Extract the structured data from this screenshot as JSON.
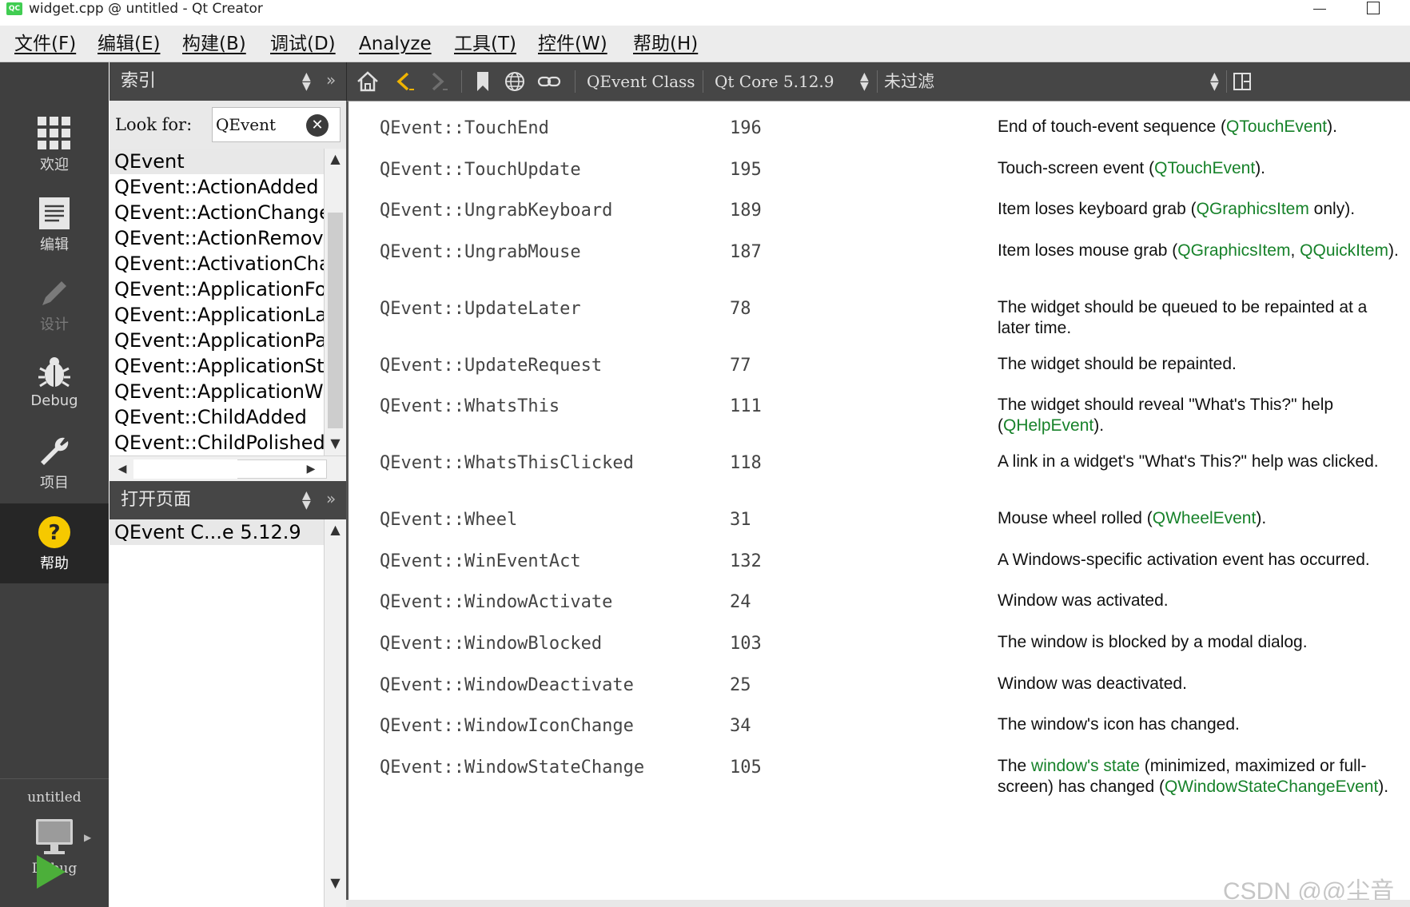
{
  "window": {
    "app_icon_text": "QC",
    "title": "widget.cpp @ untitled - Qt Creator"
  },
  "menu": [
    "文件(F)",
    "编辑(E)",
    "构建(B)",
    "调试(D)",
    "Analyze",
    "工具(T)",
    "控件(W)",
    "帮助(H)"
  ],
  "modes": {
    "welcome": "欢迎",
    "edit": "编辑",
    "design": "设计",
    "debug": "Debug",
    "project": "项目",
    "help": "帮助",
    "kit_name": "untitled",
    "kit_mode": "Debug"
  },
  "index_panel": {
    "title": "索引",
    "look_for_label": "Look for:",
    "search_value": "QEvent",
    "items": [
      "QEvent",
      "QEvent::ActionAdded",
      "QEvent::ActionChanged",
      "QEvent::ActionRemoved",
      "QEvent::ActivationChange",
      "QEvent::ApplicationFontChange",
      "QEvent::ApplicationLayoutDirectionChange",
      "QEvent::ApplicationPaletteChange",
      "QEvent::ApplicationStateChange",
      "QEvent::ApplicationWindowIconChange",
      "QEvent::ChildAdded",
      "QEvent::ChildPolished"
    ]
  },
  "open_pages": {
    "title": "打开页面",
    "items": [
      "QEvent C...e 5.12.9"
    ]
  },
  "toolbar": {
    "doc_title": "QEvent Class",
    "module": "Qt Core 5.12.9",
    "filter": "未过滤"
  },
  "content_rows": [
    {
      "name": "QEvent::TouchEnd",
      "value": "196",
      "desc": [
        {
          "t": "End of touch-event sequence ("
        },
        {
          "t": "QTouchEvent",
          "link": true
        },
        {
          "t": ")."
        }
      ]
    },
    {
      "name": "QEvent::TouchUpdate",
      "value": "195",
      "desc": [
        {
          "t": "Touch-screen event ("
        },
        {
          "t": "QTouchEvent",
          "link": true
        },
        {
          "t": ")."
        }
      ]
    },
    {
      "name": "QEvent::UngrabKeyboard",
      "value": "189",
      "desc": [
        {
          "t": "Item loses keyboard grab ("
        },
        {
          "t": "QGraphicsItem",
          "link": true
        },
        {
          "t": " only)."
        }
      ]
    },
    {
      "name": "QEvent::UngrabMouse",
      "value": "187",
      "desc": [
        {
          "t": "Item loses mouse grab ("
        },
        {
          "t": "QGraphicsItem",
          "link": true
        },
        {
          "t": ", "
        },
        {
          "t": "QQuickItem",
          "link": true
        },
        {
          "t": ")."
        }
      ]
    },
    {
      "name": "QEvent::UpdateLater",
      "value": "78",
      "desc": [
        {
          "t": "The widget should be queued to be repainted at a later time."
        }
      ]
    },
    {
      "name": "QEvent::UpdateRequest",
      "value": "77",
      "desc": [
        {
          "t": "The widget should be repainted."
        }
      ]
    },
    {
      "name": "QEvent::WhatsThis",
      "value": "111",
      "desc": [
        {
          "t": "The widget should reveal \"What's This?\" help ("
        },
        {
          "t": "QHelpEvent",
          "link": true
        },
        {
          "t": ")."
        }
      ]
    },
    {
      "name": "QEvent::WhatsThisClicked",
      "value": "118",
      "desc": [
        {
          "t": "A link in a widget's \"What's This?\" help was clicked."
        }
      ]
    },
    {
      "name": "QEvent::Wheel",
      "value": "31",
      "desc": [
        {
          "t": "Mouse wheel rolled ("
        },
        {
          "t": "QWheelEvent",
          "link": true
        },
        {
          "t": ")."
        }
      ]
    },
    {
      "name": "QEvent::WinEventAct",
      "value": "132",
      "desc": [
        {
          "t": "A Windows-specific activation event has occurred."
        }
      ]
    },
    {
      "name": "QEvent::WindowActivate",
      "value": "24",
      "desc": [
        {
          "t": "Window was activated."
        }
      ]
    },
    {
      "name": "QEvent::WindowBlocked",
      "value": "103",
      "desc": [
        {
          "t": "The window is blocked by a modal dialog."
        }
      ]
    },
    {
      "name": "QEvent::WindowDeactivate",
      "value": "25",
      "desc": [
        {
          "t": "Window was deactivated."
        }
      ]
    },
    {
      "name": "QEvent::WindowIconChange",
      "value": "34",
      "desc": [
        {
          "t": "The window's icon has changed."
        }
      ]
    },
    {
      "name": "QEvent::WindowStateChange",
      "value": "105",
      "desc": [
        {
          "t": "The "
        },
        {
          "t": "window's state",
          "link": true
        },
        {
          "t": " (minimized, maximized or full-screen) has changed ("
        },
        {
          "t": "QWindowStateChangeEvent",
          "link": true
        },
        {
          "t": ")."
        }
      ]
    }
  ],
  "watermark": "CSDN @@尘音",
  "colors": {
    "link": "#17822a",
    "mode_bar": "#3f3f3f",
    "panel_header": "#464646",
    "help_icon": "#f6c900",
    "run_icon": "#4caf3a"
  }
}
